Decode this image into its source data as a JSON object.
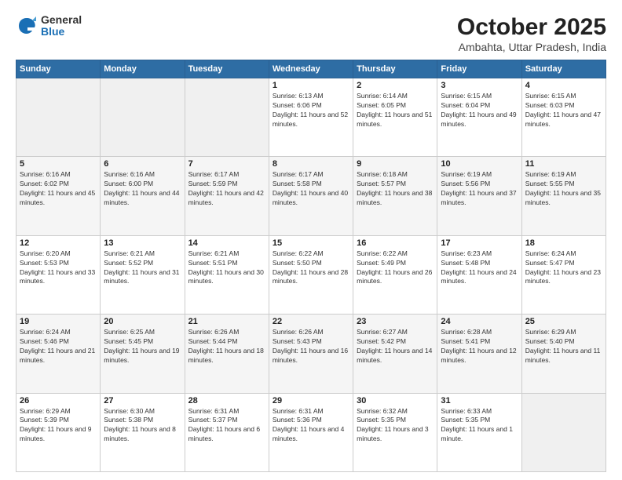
{
  "logo": {
    "general": "General",
    "blue": "Blue"
  },
  "title": "October 2025",
  "location": "Ambahta, Uttar Pradesh, India",
  "days_of_week": [
    "Sunday",
    "Monday",
    "Tuesday",
    "Wednesday",
    "Thursday",
    "Friday",
    "Saturday"
  ],
  "weeks": [
    [
      {
        "day": "",
        "info": ""
      },
      {
        "day": "",
        "info": ""
      },
      {
        "day": "",
        "info": ""
      },
      {
        "day": "1",
        "info": "Sunrise: 6:13 AM\nSunset: 6:06 PM\nDaylight: 11 hours and 52 minutes."
      },
      {
        "day": "2",
        "info": "Sunrise: 6:14 AM\nSunset: 6:05 PM\nDaylight: 11 hours and 51 minutes."
      },
      {
        "day": "3",
        "info": "Sunrise: 6:15 AM\nSunset: 6:04 PM\nDaylight: 11 hours and 49 minutes."
      },
      {
        "day": "4",
        "info": "Sunrise: 6:15 AM\nSunset: 6:03 PM\nDaylight: 11 hours and 47 minutes."
      }
    ],
    [
      {
        "day": "5",
        "info": "Sunrise: 6:16 AM\nSunset: 6:02 PM\nDaylight: 11 hours and 45 minutes."
      },
      {
        "day": "6",
        "info": "Sunrise: 6:16 AM\nSunset: 6:00 PM\nDaylight: 11 hours and 44 minutes."
      },
      {
        "day": "7",
        "info": "Sunrise: 6:17 AM\nSunset: 5:59 PM\nDaylight: 11 hours and 42 minutes."
      },
      {
        "day": "8",
        "info": "Sunrise: 6:17 AM\nSunset: 5:58 PM\nDaylight: 11 hours and 40 minutes."
      },
      {
        "day": "9",
        "info": "Sunrise: 6:18 AM\nSunset: 5:57 PM\nDaylight: 11 hours and 38 minutes."
      },
      {
        "day": "10",
        "info": "Sunrise: 6:19 AM\nSunset: 5:56 PM\nDaylight: 11 hours and 37 minutes."
      },
      {
        "day": "11",
        "info": "Sunrise: 6:19 AM\nSunset: 5:55 PM\nDaylight: 11 hours and 35 minutes."
      }
    ],
    [
      {
        "day": "12",
        "info": "Sunrise: 6:20 AM\nSunset: 5:53 PM\nDaylight: 11 hours and 33 minutes."
      },
      {
        "day": "13",
        "info": "Sunrise: 6:21 AM\nSunset: 5:52 PM\nDaylight: 11 hours and 31 minutes."
      },
      {
        "day": "14",
        "info": "Sunrise: 6:21 AM\nSunset: 5:51 PM\nDaylight: 11 hours and 30 minutes."
      },
      {
        "day": "15",
        "info": "Sunrise: 6:22 AM\nSunset: 5:50 PM\nDaylight: 11 hours and 28 minutes."
      },
      {
        "day": "16",
        "info": "Sunrise: 6:22 AM\nSunset: 5:49 PM\nDaylight: 11 hours and 26 minutes."
      },
      {
        "day": "17",
        "info": "Sunrise: 6:23 AM\nSunset: 5:48 PM\nDaylight: 11 hours and 24 minutes."
      },
      {
        "day": "18",
        "info": "Sunrise: 6:24 AM\nSunset: 5:47 PM\nDaylight: 11 hours and 23 minutes."
      }
    ],
    [
      {
        "day": "19",
        "info": "Sunrise: 6:24 AM\nSunset: 5:46 PM\nDaylight: 11 hours and 21 minutes."
      },
      {
        "day": "20",
        "info": "Sunrise: 6:25 AM\nSunset: 5:45 PM\nDaylight: 11 hours and 19 minutes."
      },
      {
        "day": "21",
        "info": "Sunrise: 6:26 AM\nSunset: 5:44 PM\nDaylight: 11 hours and 18 minutes."
      },
      {
        "day": "22",
        "info": "Sunrise: 6:26 AM\nSunset: 5:43 PM\nDaylight: 11 hours and 16 minutes."
      },
      {
        "day": "23",
        "info": "Sunrise: 6:27 AM\nSunset: 5:42 PM\nDaylight: 11 hours and 14 minutes."
      },
      {
        "day": "24",
        "info": "Sunrise: 6:28 AM\nSunset: 5:41 PM\nDaylight: 11 hours and 12 minutes."
      },
      {
        "day": "25",
        "info": "Sunrise: 6:29 AM\nSunset: 5:40 PM\nDaylight: 11 hours and 11 minutes."
      }
    ],
    [
      {
        "day": "26",
        "info": "Sunrise: 6:29 AM\nSunset: 5:39 PM\nDaylight: 11 hours and 9 minutes."
      },
      {
        "day": "27",
        "info": "Sunrise: 6:30 AM\nSunset: 5:38 PM\nDaylight: 11 hours and 8 minutes."
      },
      {
        "day": "28",
        "info": "Sunrise: 6:31 AM\nSunset: 5:37 PM\nDaylight: 11 hours and 6 minutes."
      },
      {
        "day": "29",
        "info": "Sunrise: 6:31 AM\nSunset: 5:36 PM\nDaylight: 11 hours and 4 minutes."
      },
      {
        "day": "30",
        "info": "Sunrise: 6:32 AM\nSunset: 5:35 PM\nDaylight: 11 hours and 3 minutes."
      },
      {
        "day": "31",
        "info": "Sunrise: 6:33 AM\nSunset: 5:35 PM\nDaylight: 11 hours and 1 minute."
      },
      {
        "day": "",
        "info": ""
      }
    ]
  ]
}
